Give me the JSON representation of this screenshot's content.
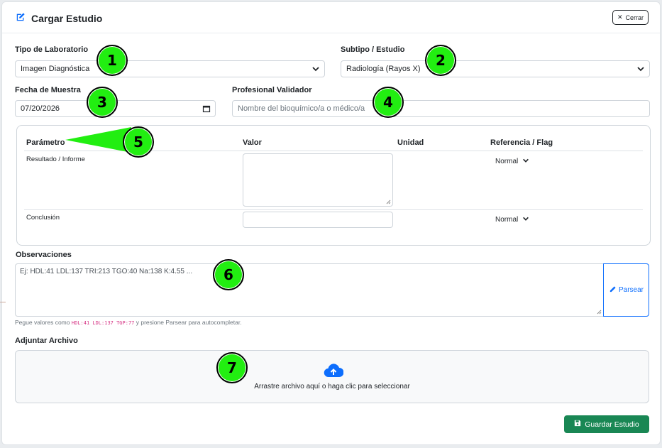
{
  "modal": {
    "title": "Cargar Estudio",
    "close_label": "Cerrar"
  },
  "form": {
    "tipo_label": "Tipo de Laboratorio",
    "tipo_value": "Imagen Diagnóstica",
    "subtipo_label": "Subtipo / Estudio",
    "subtipo_value": "Radiología (Rayos X)",
    "fecha_label": "Fecha de Muestra",
    "fecha_value": "07/20/2026",
    "profesional_label": "Profesional Validador",
    "profesional_placeholder": "Nombre del bioquímico/a o médico/a"
  },
  "params": {
    "headers": [
      "Parámetro",
      "Valor",
      "Unidad",
      "Referencia / Flag"
    ],
    "rows": [
      {
        "name": "Resultado / Informe",
        "flag": "Normal"
      },
      {
        "name": "Conclusión",
        "flag": "Normal"
      }
    ]
  },
  "observaciones": {
    "label": "Observaciones",
    "placeholder": "Ej: HDL:41 LDL:137 TRI:213 TGO:40 Na:138 K:4.55 ...",
    "parse_label": "Parsear",
    "help_prefix": "Pegue valores como",
    "help_code": "HDL:41 LDL:137 TGP:77",
    "help_suffix": "y presione Parsear para autocompletar."
  },
  "adjuntar": {
    "label": "Adjuntar Archivo",
    "drop_text": "Arrastre archivo aquí o haga clic para seleccionar"
  },
  "save_label": "Guardar Estudio",
  "badges": [
    "1",
    "2",
    "3",
    "4",
    "5",
    "6",
    "7"
  ],
  "colors": {
    "primary": "#0d6efd",
    "success": "#198754",
    "badge": "#22ee11"
  }
}
